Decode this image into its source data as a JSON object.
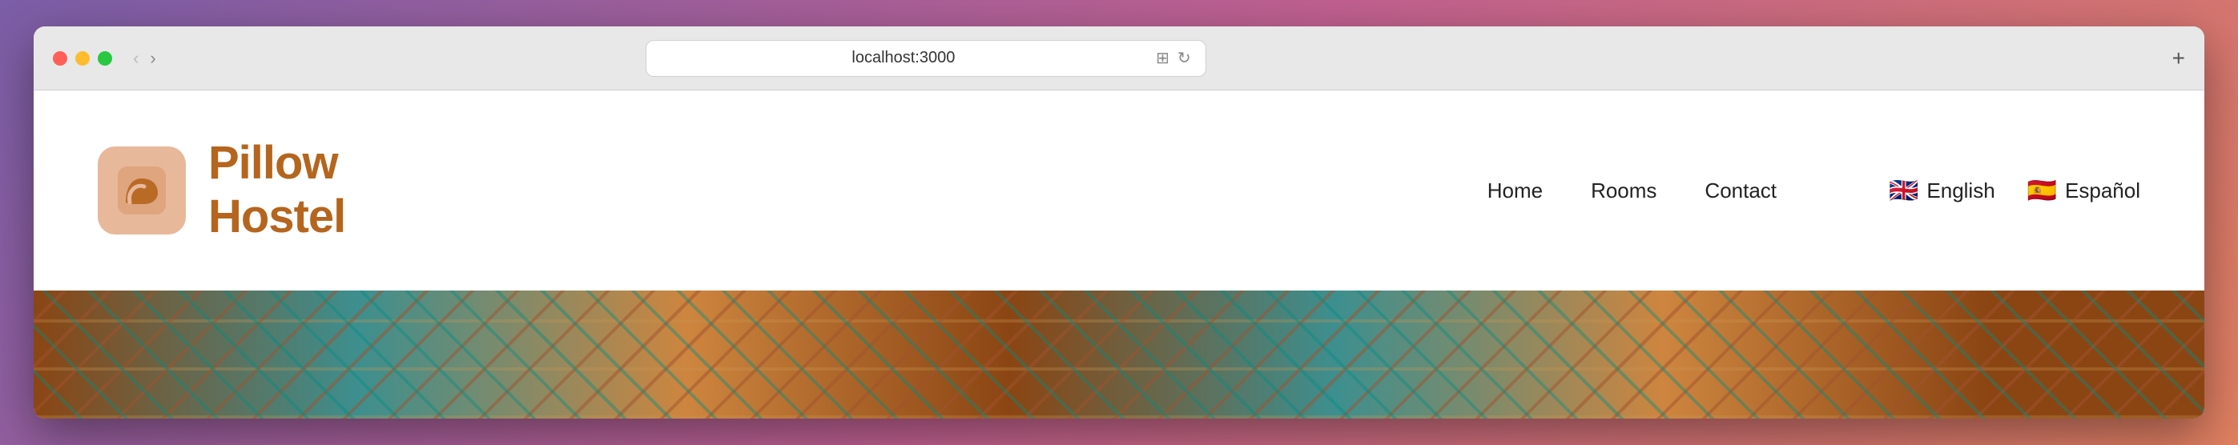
{
  "browser": {
    "address": "localhost:3000",
    "back_btn": "‹",
    "forward_btn": "›",
    "new_tab_btn": "+"
  },
  "site": {
    "logo": {
      "text_line1": "Pillow",
      "text_line2": "Hostel"
    },
    "nav": {
      "home": "Home",
      "rooms": "Rooms",
      "contact": "Contact"
    },
    "languages": {
      "english": {
        "flag": "🇬🇧",
        "label": "English"
      },
      "spanish": {
        "flag": "🇪🇸",
        "label": "Español"
      }
    }
  }
}
